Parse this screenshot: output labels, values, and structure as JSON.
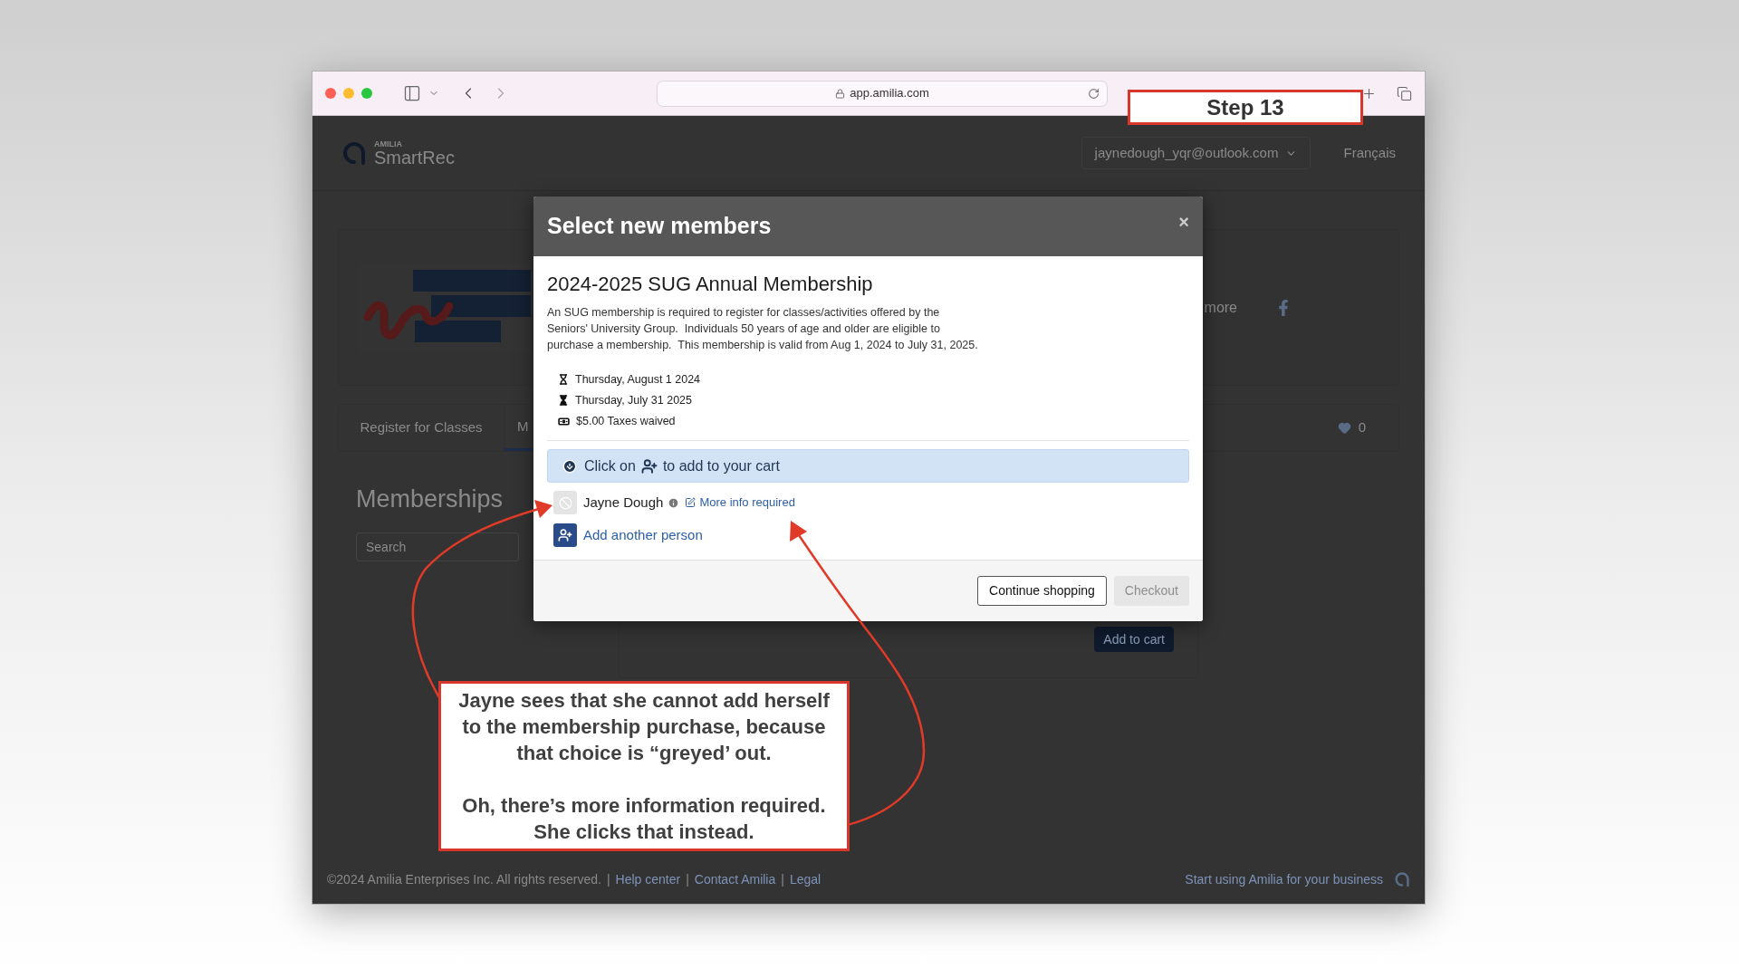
{
  "browser": {
    "url": "app.amilia.com"
  },
  "step_badge": "Step 13",
  "header": {
    "logo_small": "AMILIA",
    "logo": "SmartRec",
    "account": "jaynedough_yqr@outlook.com",
    "language": "Français"
  },
  "org_card": {
    "more_link": "more"
  },
  "tabs": [
    {
      "label": "Register for Classes",
      "selected": false
    },
    {
      "label": "M",
      "selected": true
    }
  ],
  "favorites_count": "0",
  "page_title": "Memberships",
  "search": {
    "placeholder": "Search"
  },
  "add_to_cart": "Add to cart",
  "modal": {
    "title": "Select new members",
    "close": "×",
    "product_title": "2024-2025 SUG Annual Membership",
    "description": "An SUG membership is required to register for classes/activities offered by the\nSeniors' University Group.  Individuals 50 years of age and older are eligible to\npurchase a membership.  This membership is valid from Aug 1, 2024 to July 31, 2025.",
    "details": [
      {
        "kind": "start_date",
        "text": "Thursday, August 1 2024"
      },
      {
        "kind": "end_date",
        "text": "Thursday, July 31 2025"
      },
      {
        "kind": "price",
        "text": "$5.00 Taxes waived"
      }
    ],
    "hint": {
      "before": "Click on",
      "after": "to add to your cart"
    },
    "members": [
      {
        "name": "Jayne Dough",
        "disabled": true,
        "link": "More info required"
      }
    ],
    "add_person": "Add another person",
    "buttons": [
      {
        "label": "Continue shopping",
        "disabled": false
      },
      {
        "label": "Checkout",
        "disabled": true
      }
    ]
  },
  "footer": {
    "left": [
      {
        "kind": "text",
        "text": "©2024 Amilia Enterprises Inc. All rights reserved."
      },
      {
        "kind": "separator",
        "text": "|"
      },
      {
        "kind": "link",
        "text": "Help center"
      },
      {
        "kind": "separator",
        "text": "|"
      },
      {
        "kind": "link",
        "text": "Contact Amilia"
      },
      {
        "kind": "separator",
        "text": "|"
      },
      {
        "kind": "link",
        "text": "Legal"
      }
    ],
    "right": "Start using Amilia for your business"
  },
  "callout": "Jayne sees that she cannot add herself\nto the membership purchase, because\nthat choice is “greyed’ out.\n\nOh, there’s more information required.\nShe clicks that instead."
}
